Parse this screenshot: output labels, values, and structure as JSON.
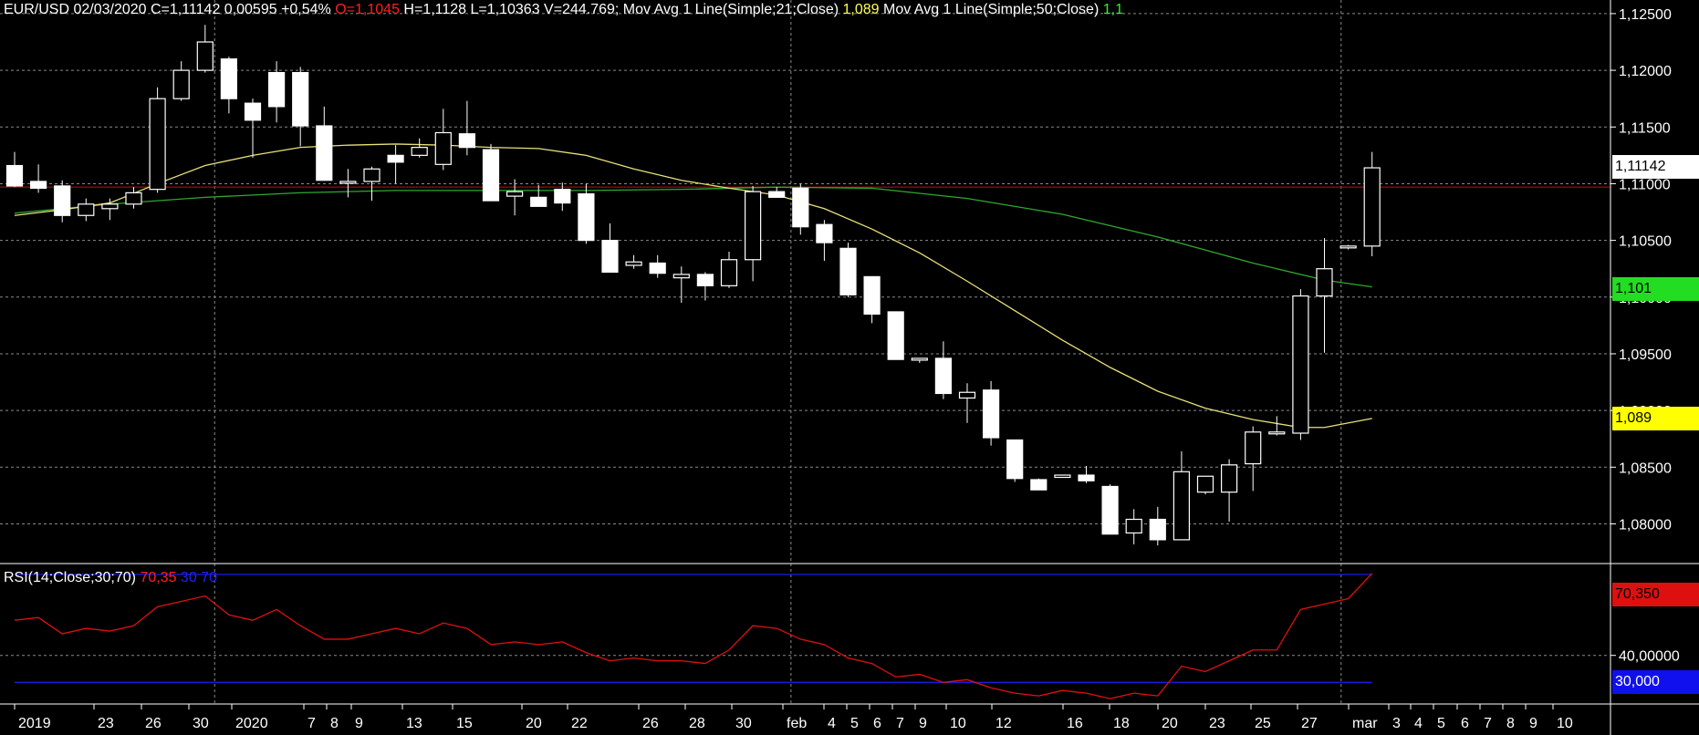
{
  "header": {
    "prefix": "EUR/USD 02/03/2020 C=1,11142 0,00595 +0,54%",
    "open": "O=1,1045",
    "hlv": "H=1,1128 L=1,10363 V=244.769;",
    "ma21_label": "Mov Avg 1 Line(Simple;21;Close)",
    "ma21_value": "1,089",
    "ma50_label": "Mov Avg 1 Line(Simple;50;Close)",
    "ma50_value": "1,1"
  },
  "rsi_header": {
    "label": "RSI(14;Close;30;70)",
    "value": "70,35",
    "levels": "30 70"
  },
  "tags": {
    "last": "1,11142",
    "ma50": "1,101",
    "ma21": "1,089",
    "rsi": "70,350",
    "rsi_low": "30,000"
  },
  "colors": {
    "background": "#000000",
    "grid": "#8a8a8a",
    "candle": "#ffffff",
    "ma21": "#e8e07a",
    "ma50": "#2fa82f",
    "rsi": "#e01010",
    "rsi_levels": "#1a1ae0",
    "price_line": "#c01010",
    "ma50_tag": "#22dd22",
    "ma21_tag": "#ffff00"
  },
  "chart_data": [
    {
      "type": "candlestick",
      "title": "EUR/USD",
      "x_labels": [
        "2019",
        "23",
        "26",
        "30",
        "2020",
        "7",
        "8",
        "9",
        "13",
        "15",
        "20",
        "22",
        "26",
        "28",
        "30",
        "feb",
        "4",
        "5",
        "6",
        "7",
        "9",
        "10",
        "12",
        "16",
        "18",
        "20",
        "23",
        "25",
        "27",
        "mar",
        "3",
        "4",
        "5",
        "6",
        "7",
        "8",
        "9",
        "10"
      ],
      "y_ticks": [
        "1,12500",
        "1,12000",
        "1,11500",
        "1,11000",
        "1,10500",
        "1,10000",
        "1,09500",
        "1,09000",
        "1,08500",
        "1,08000"
      ],
      "ylim": [
        1.0765,
        1.1262
      ],
      "ohlc": [
        [
          1.1116,
          1.1128,
          1.1097,
          1.1098
        ],
        [
          1.1102,
          1.1117,
          1.1092,
          1.1096
        ],
        [
          1.1098,
          1.1103,
          1.1066,
          1.1072
        ],
        [
          1.1072,
          1.1087,
          1.1067,
          1.1082
        ],
        [
          1.1078,
          1.1087,
          1.1068,
          1.1082
        ],
        [
          1.1082,
          1.1097,
          1.1078,
          1.1092
        ],
        [
          1.1095,
          1.1185,
          1.1092,
          1.1175
        ],
        [
          1.1175,
          1.1208,
          1.1173,
          1.12
        ],
        [
          1.12,
          1.124,
          1.1198,
          1.1225
        ],
        [
          1.121,
          1.1212,
          1.1162,
          1.1175
        ],
        [
          1.1171,
          1.1175,
          1.1123,
          1.1156
        ],
        [
          1.1198,
          1.1208,
          1.1154,
          1.1168
        ],
        [
          1.1198,
          1.1203,
          1.1133,
          1.1151
        ],
        [
          1.1151,
          1.1168,
          1.112,
          1.1103
        ],
        [
          1.1102,
          1.1113,
          1.1088,
          1.1102
        ],
        [
          1.1102,
          1.1115,
          1.1085,
          1.1113
        ],
        [
          1.1125,
          1.1134,
          1.11,
          1.1119
        ],
        [
          1.1125,
          1.114,
          1.1123,
          1.1132
        ],
        [
          1.1117,
          1.1166,
          1.1112,
          1.1145
        ],
        [
          1.1144,
          1.1173,
          1.1125,
          1.1132
        ],
        [
          1.113,
          1.1135,
          1.1087,
          1.1085
        ],
        [
          1.1089,
          1.1104,
          1.1072,
          1.1093
        ],
        [
          1.1088,
          1.1099,
          1.1083,
          1.108
        ],
        [
          1.1095,
          1.1101,
          1.1076,
          1.1083
        ],
        [
          1.1091,
          1.11,
          1.1047,
          1.105
        ],
        [
          1.105,
          1.1065,
          1.1038,
          1.1022
        ],
        [
          1.1028,
          1.1037,
          1.1025,
          1.1031
        ],
        [
          1.103,
          1.1037,
          1.1017,
          1.1021
        ],
        [
          1.1017,
          1.1027,
          1.0995,
          1.102
        ],
        [
          1.102,
          1.1022,
          1.0997,
          1.101
        ],
        [
          1.101,
          1.104,
          1.1008,
          1.1033
        ],
        [
          1.1033,
          1.1098,
          1.1014,
          1.1093
        ],
        [
          1.1093,
          1.1097,
          1.1088,
          1.1088
        ],
        [
          1.1096,
          1.11,
          1.1055,
          1.1062
        ],
        [
          1.1064,
          1.1068,
          1.1032,
          1.1048
        ],
        [
          1.1043,
          1.1048,
          1.1,
          1.1002
        ],
        [
          1.1018,
          1.1015,
          1.0977,
          1.0985
        ],
        [
          1.0987,
          1.0986,
          1.0945,
          1.0945
        ],
        [
          1.0946,
          1.0946,
          1.0942,
          1.0946
        ],
        [
          1.0946,
          1.0961,
          1.091,
          1.0915
        ],
        [
          1.0911,
          1.0924,
          1.0889,
          1.0916
        ],
        [
          1.0918,
          1.0926,
          1.0869,
          1.0876
        ],
        [
          1.0874,
          1.0863,
          1.0837,
          1.084
        ],
        [
          1.0839,
          1.084,
          1.0832,
          1.083
        ],
        [
          1.0841,
          1.0843,
          1.0842,
          1.0843
        ],
        [
          1.0843,
          1.0851,
          1.0836,
          1.0838
        ],
        [
          1.0833,
          1.0835,
          1.0793,
          1.0791
        ],
        [
          1.0792,
          1.0813,
          1.0782,
          1.0804
        ],
        [
          1.0804,
          1.0815,
          1.0781,
          1.0786
        ],
        [
          1.0786,
          1.0864,
          1.0786,
          1.0846
        ],
        [
          1.0828,
          1.0838,
          1.0826,
          1.0842
        ],
        [
          1.0828,
          1.0857,
          1.0802,
          1.0852
        ],
        [
          1.0853,
          1.0886,
          1.0829,
          1.0881
        ],
        [
          1.088,
          1.0895,
          1.0878,
          1.0881
        ],
        [
          1.088,
          1.1007,
          1.0874,
          1.1001
        ],
        [
          1.1001,
          1.1052,
          1.0951,
          1.1025
        ],
        [
          1.1045,
          1.1046,
          1.1042,
          1.1045
        ],
        [
          1.1045,
          1.1128,
          1.1036,
          1.1114
        ]
      ],
      "ma21": [
        [
          1,
          1.1072
        ],
        [
          3,
          1.1077
        ],
        [
          5,
          1.1083
        ],
        [
          7,
          1.11
        ],
        [
          9,
          1.1116
        ],
        [
          11,
          1.1125
        ],
        [
          13,
          1.1132
        ],
        [
          15,
          1.1134
        ],
        [
          17,
          1.1135
        ],
        [
          19,
          1.1134
        ],
        [
          21,
          1.1132
        ],
        [
          23,
          1.1131
        ],
        [
          25,
          1.1125
        ],
        [
          27,
          1.1113
        ],
        [
          29,
          1.1103
        ],
        [
          31,
          1.1096
        ],
        [
          33,
          1.109
        ],
        [
          35,
          1.1078
        ],
        [
          37,
          1.106
        ],
        [
          39,
          1.1039
        ],
        [
          41,
          1.1014
        ],
        [
          43,
          1.0988
        ],
        [
          45,
          1.0962
        ],
        [
          47,
          1.0938
        ],
        [
          49,
          1.0917
        ],
        [
          51,
          1.0902
        ],
        [
          53,
          1.0892
        ],
        [
          55,
          1.0885
        ],
        [
          56,
          1.0885
        ],
        [
          58,
          1.0893
        ]
      ],
      "ma50": [
        [
          1,
          1.1074
        ],
        [
          5,
          1.1082
        ],
        [
          9,
          1.1088
        ],
        [
          13,
          1.1092
        ],
        [
          17,
          1.1094
        ],
        [
          21,
          1.1094
        ],
        [
          25,
          1.1094
        ],
        [
          29,
          1.1095
        ],
        [
          33,
          1.1097
        ],
        [
          37,
          1.1096
        ],
        [
          41,
          1.1087
        ],
        [
          45,
          1.1073
        ],
        [
          49,
          1.1053
        ],
        [
          53,
          1.103
        ],
        [
          56,
          1.1015
        ],
        [
          58,
          1.1009
        ]
      ],
      "last_price": 1.1097
    },
    {
      "type": "line",
      "title": "RSI(14;Close;30;70)",
      "y_ticks": [
        "40,00000"
      ],
      "levels": [
        30,
        70
      ],
      "ylim": [
        22,
        74
      ],
      "values": [
        [
          1,
          53
        ],
        [
          2,
          54
        ],
        [
          3,
          48
        ],
        [
          4,
          50
        ],
        [
          5,
          49
        ],
        [
          6,
          51
        ],
        [
          7,
          58
        ],
        [
          8,
          60
        ],
        [
          9,
          62
        ],
        [
          10,
          55
        ],
        [
          11,
          53
        ],
        [
          12,
          57
        ],
        [
          13,
          51
        ],
        [
          14,
          46
        ],
        [
          15,
          46
        ],
        [
          16,
          48
        ],
        [
          17,
          50
        ],
        [
          18,
          48
        ],
        [
          19,
          52
        ],
        [
          20,
          50
        ],
        [
          21,
          44
        ],
        [
          22,
          45
        ],
        [
          23,
          44
        ],
        [
          24,
          45
        ],
        [
          25,
          41
        ],
        [
          26,
          38
        ],
        [
          27,
          39
        ],
        [
          28,
          38
        ],
        [
          29,
          38
        ],
        [
          30,
          37
        ],
        [
          31,
          42
        ],
        [
          32,
          51
        ],
        [
          33,
          50
        ],
        [
          34,
          46
        ],
        [
          35,
          44
        ],
        [
          36,
          39
        ],
        [
          37,
          37
        ],
        [
          38,
          32
        ],
        [
          39,
          33
        ],
        [
          40,
          30
        ],
        [
          41,
          31
        ],
        [
          42,
          28
        ],
        [
          43,
          26
        ],
        [
          44,
          25
        ],
        [
          45,
          27
        ],
        [
          46,
          26
        ],
        [
          47,
          24
        ],
        [
          48,
          26
        ],
        [
          49,
          25
        ],
        [
          50,
          36
        ],
        [
          51,
          34
        ],
        [
          52,
          38
        ],
        [
          53,
          42
        ],
        [
          54,
          42
        ],
        [
          55,
          57
        ],
        [
          56,
          59
        ],
        [
          57,
          61
        ],
        [
          58,
          70.35
        ]
      ]
    }
  ]
}
